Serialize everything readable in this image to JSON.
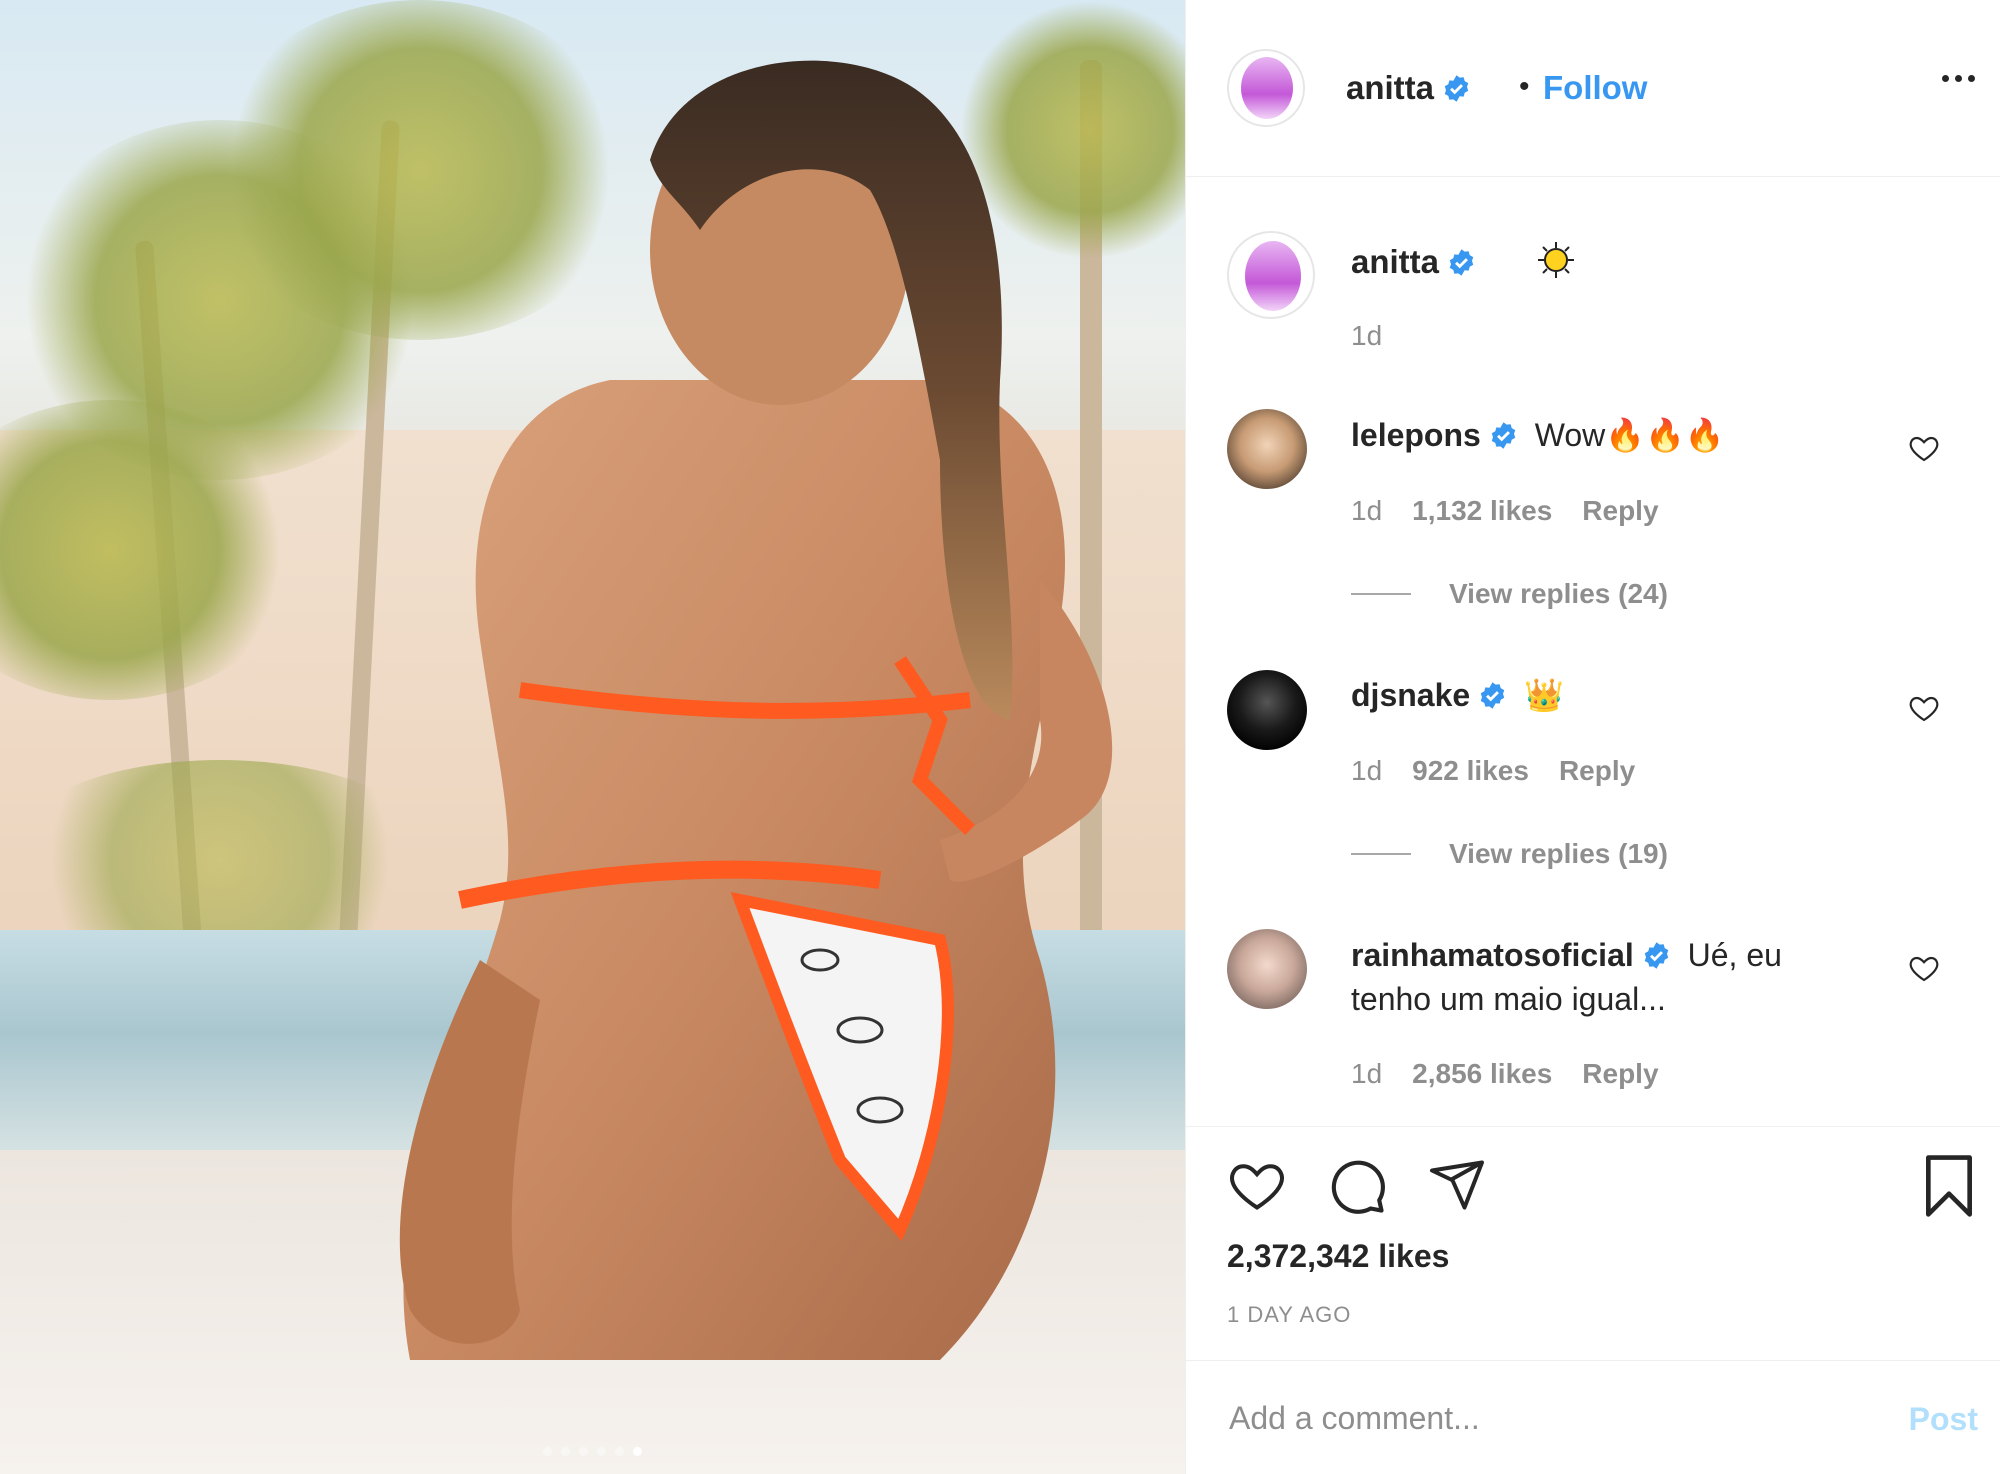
{
  "header": {
    "username": "anitta",
    "separator": "•",
    "follow_label": "Follow",
    "more_icon": "more-options-icon"
  },
  "caption": {
    "username": "anitta",
    "emoji": "sun-emoji",
    "time": "1d"
  },
  "comments": [
    {
      "username": "lelepons",
      "text": "Wow🔥🔥🔥",
      "time": "1d",
      "likes": "1,132 likes",
      "reply_label": "Reply",
      "view_replies": "View replies (24)"
    },
    {
      "username": "djsnake",
      "text": "👑",
      "time": "1d",
      "likes": "922 likes",
      "reply_label": "Reply",
      "view_replies": "View replies (19)"
    },
    {
      "username": "rainhamatosoficial",
      "text_line1": "Ué, eu",
      "text_line2": "tenho um maio igual...",
      "time": "1d",
      "likes": "2,856 likes",
      "reply_label": "Reply"
    }
  ],
  "actions": {
    "like_icon": "heart-icon",
    "comment_icon": "comment-icon",
    "share_icon": "share-icon",
    "save_icon": "bookmark-icon",
    "total_likes": "2,372,342 likes",
    "time_ago": "1 DAY AGO"
  },
  "comment_box": {
    "placeholder": "Add a comment...",
    "post_label": "Post"
  },
  "colors": {
    "link_blue": "#3897f0",
    "muted": "#8e8e8e",
    "text": "#262626",
    "post_disabled": "#b2dffc",
    "bikini_orange": "#ff5a1f"
  },
  "carousel": {
    "count": 6,
    "active_index": 5
  }
}
